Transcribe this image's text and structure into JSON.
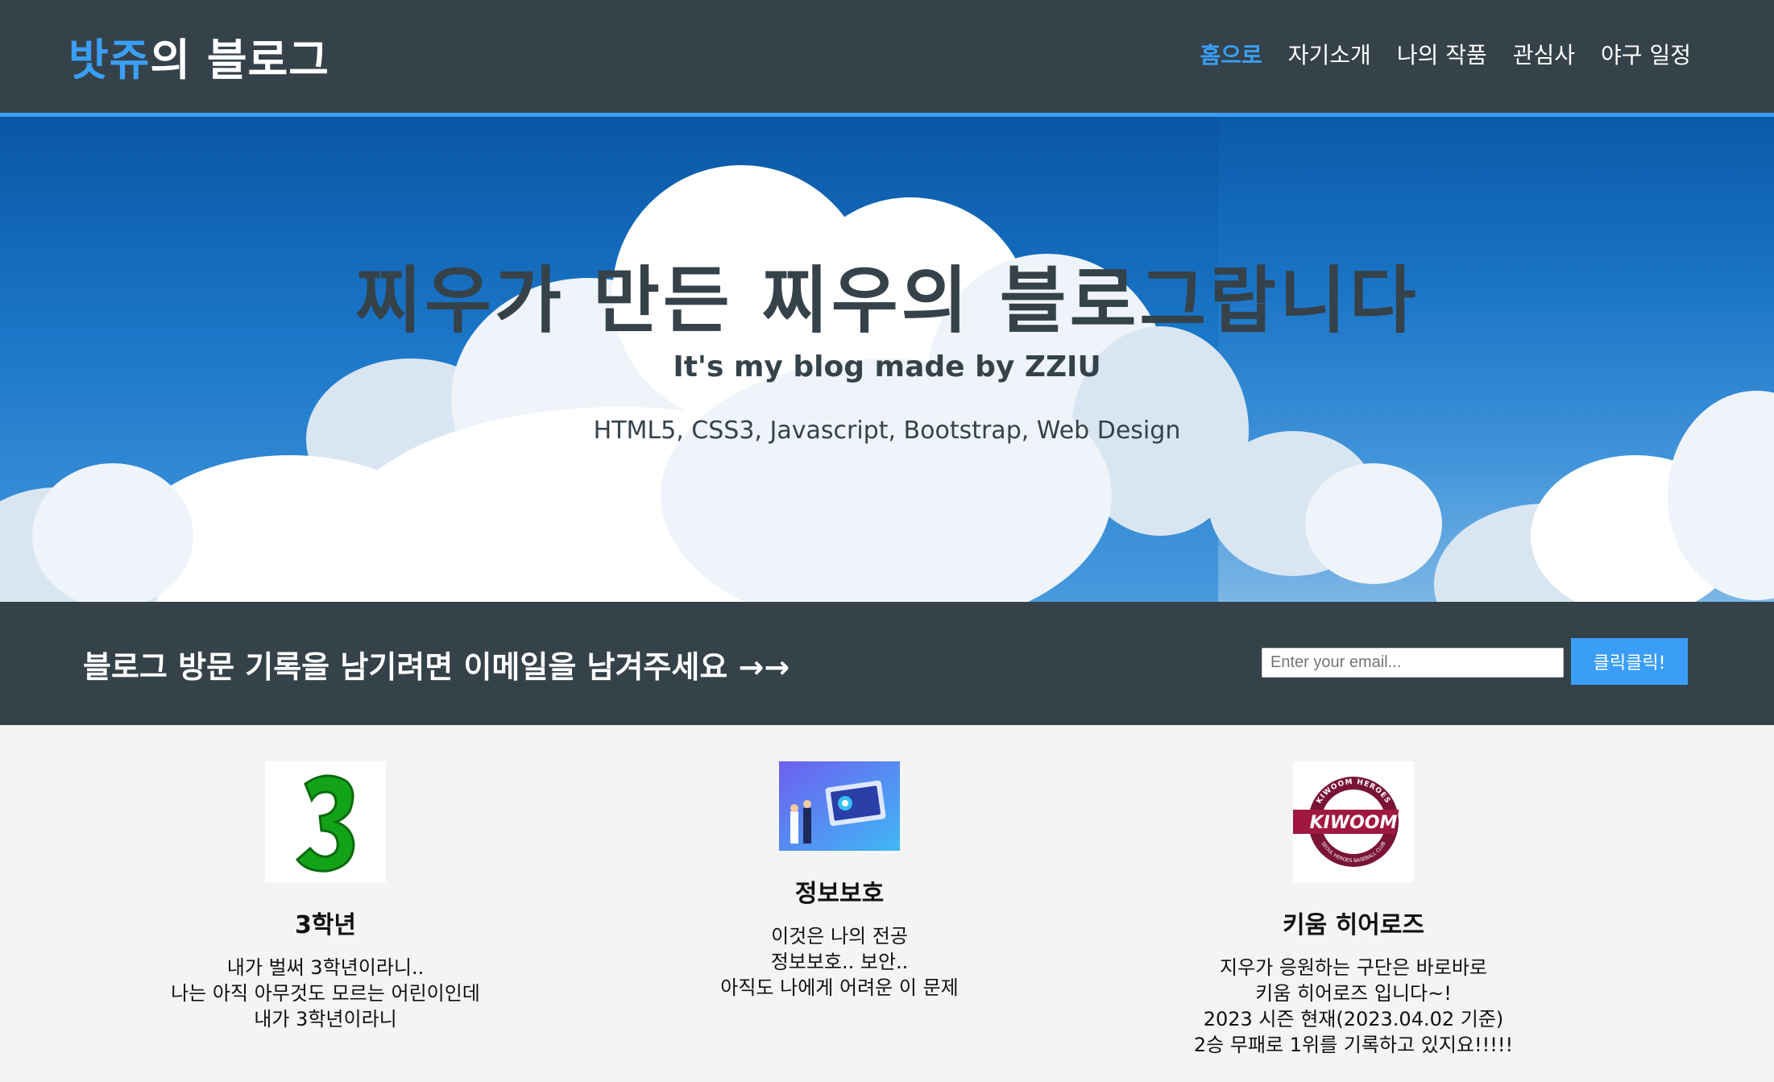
{
  "header": {
    "logo_highlight": "밧쥬",
    "logo_rest": "의 블로그",
    "nav": [
      {
        "label": "홈으로",
        "active": true
      },
      {
        "label": "자기소개",
        "active": false
      },
      {
        "label": "나의 작품",
        "active": false
      },
      {
        "label": "관심사",
        "active": false
      },
      {
        "label": "야구 일정",
        "active": false
      }
    ]
  },
  "hero": {
    "title": "찌우가 만든 찌우의 블로그랍니다",
    "subtitle": "It's my blog made by ZZIU",
    "tags": "HTML5, CSS3, Javascript, Bootstrap, Web Design"
  },
  "newsletter": {
    "heading": "블로그 방문 기록을 남기려면 이메일을 남겨주세요 →→",
    "email_placeholder": "Enter your email...",
    "button_label": "클릭클릭!"
  },
  "boxes": [
    {
      "icon": "number-three-icon",
      "title": "3학년",
      "lines": [
        "내가 벌써 3학년이라니..",
        "나는 아직 아무것도 모르는 어린이인데",
        "내가 3학년이라니"
      ]
    },
    {
      "icon": "security-illustration-icon",
      "title": "정보보호",
      "lines": [
        "이것은 나의 전공",
        "정보보호.. 보안..",
        "아직도 나에게 어려운 이 문제"
      ]
    },
    {
      "icon": "kiwoom-heroes-logo-icon",
      "logo_text": "KIWOOM",
      "logo_ring_top": "KIWOOM HEROES",
      "logo_ring_bottom": "SEOUL HEROES BASEBALL CLUB",
      "title": "키움 히어로즈",
      "lines": [
        "지우가 응원하는 구단은 바로바로",
        "키움 히어로즈 입니다~!",
        "2023 시즌 현재(2023.04.02 기준)",
        "2승 무패로 1위를 기록하고 있지요!!!!!"
      ]
    }
  ],
  "colors": {
    "header_bg": "#35424a",
    "accent": "#3a9ef6",
    "body_bg": "#f4f4f4"
  }
}
